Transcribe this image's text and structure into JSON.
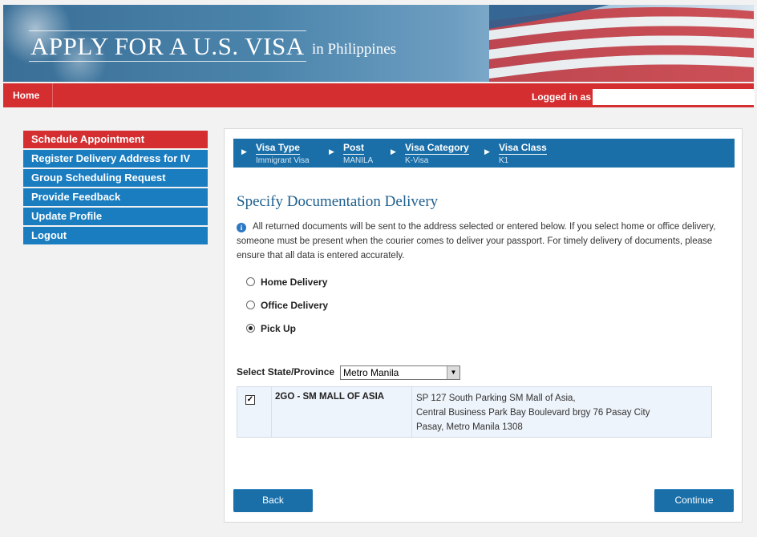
{
  "banner": {
    "title": "APPLY FOR A U.S. VISA",
    "subtitle": "in Philippines"
  },
  "nav": {
    "home": "Home",
    "logged_in_label": "Logged in as",
    "username": ""
  },
  "sidebar": {
    "items": [
      {
        "label": "Schedule Appointment",
        "active": true
      },
      {
        "label": "Register Delivery Address for IV"
      },
      {
        "label": "Group Scheduling Request"
      },
      {
        "label": "Provide Feedback"
      },
      {
        "label": "Update Profile"
      },
      {
        "label": "Logout"
      }
    ]
  },
  "breadcrumbs": [
    {
      "label": "Visa Type",
      "value": "Immigrant Visa"
    },
    {
      "label": "Post",
      "value": "MANILA"
    },
    {
      "label": "Visa Category",
      "value": "K-Visa"
    },
    {
      "label": "Visa Class",
      "value": "K1"
    }
  ],
  "main": {
    "heading": "Specify Documentation Delivery",
    "info_icon": "info-icon",
    "info_text": "All returned documents will be sent to the address selected or entered below. If you select home or office delivery, someone must be present when the courier comes to deliver your passport. For timely delivery of documents, please ensure that all data is entered accurately.",
    "delivery_options": [
      {
        "label": "Home Delivery",
        "selected": false
      },
      {
        "label": "Office Delivery",
        "selected": false
      },
      {
        "label": "Pick Up",
        "selected": true
      }
    ],
    "state_label": "Select State/Province",
    "state_value": "Metro Manila",
    "location": {
      "checked": true,
      "name": "2GO - SM MALL OF ASIA",
      "address_line1": "SP 127 South Parking SM Mall of Asia,",
      "address_line2": "Central Business Park Bay Boulevard brgy 76 Pasay City",
      "address_line3": "Pasay, Metro Manila 1308"
    },
    "back_label": "Back",
    "continue_label": "Continue"
  },
  "colors": {
    "nav_red": "#d42e30",
    "menu_blue": "#1a7dc0",
    "button_blue": "#1a6fa9",
    "heading_blue": "#1e5f8f"
  }
}
